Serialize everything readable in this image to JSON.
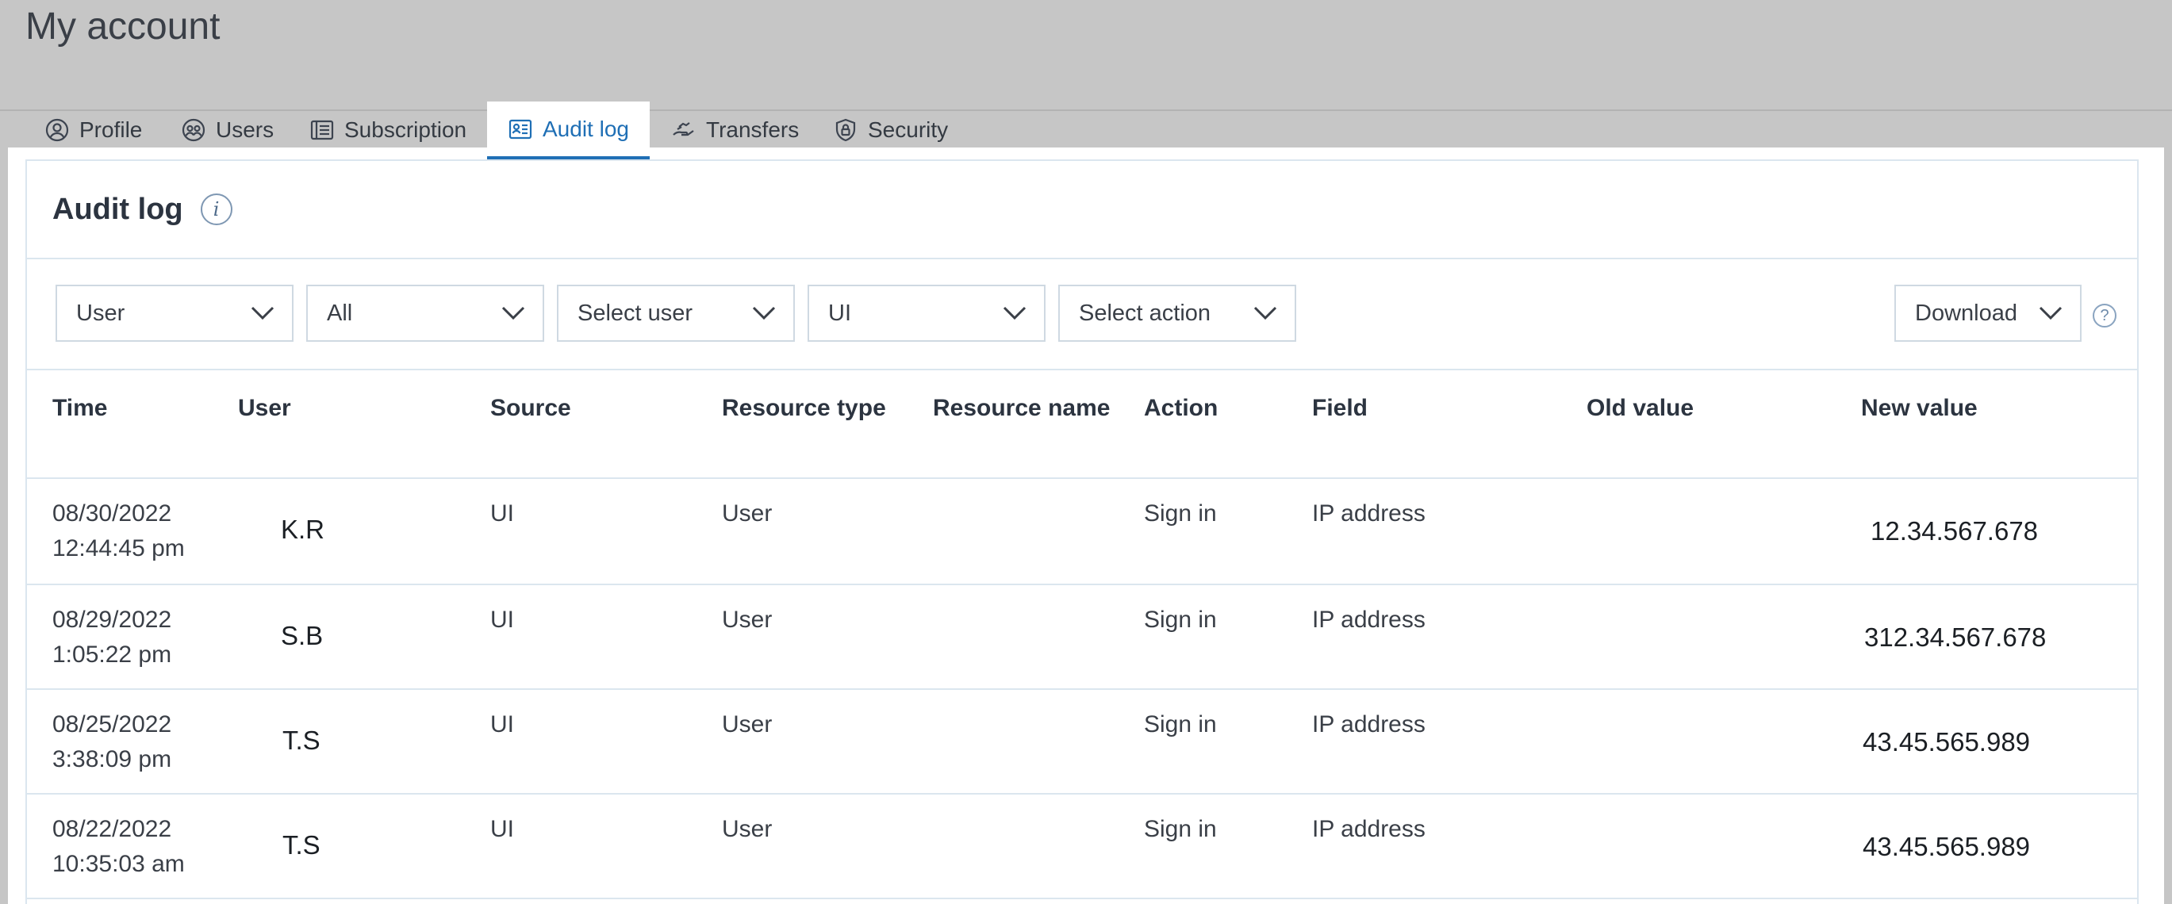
{
  "page": {
    "title": "My account"
  },
  "tabs": [
    {
      "label": "Profile",
      "icon": "user-circle-icon"
    },
    {
      "label": "Users",
      "icon": "users-icon"
    },
    {
      "label": "Subscription",
      "icon": "document-icon"
    },
    {
      "label": "Audit log",
      "icon": "id-card-icon",
      "active": true
    },
    {
      "label": "Transfers",
      "icon": "hand-transfer-icon"
    },
    {
      "label": "Security",
      "icon": "shield-lock-icon"
    }
  ],
  "card": {
    "title": "Audit log",
    "info_symbol": "i"
  },
  "filters": {
    "type": "User",
    "scope": "All",
    "user": "Select user",
    "source": "UI",
    "action": "Select action",
    "download": "Download",
    "help_symbol": "?"
  },
  "table": {
    "columns": [
      "Time",
      "User",
      "Source",
      "Resource type",
      "Resource name",
      "Action",
      "Field",
      "Old value",
      "New value"
    ],
    "rows": [
      {
        "date": "08/30/2022",
        "time": "12:44:45 pm",
        "user": "K.R",
        "source": "UI",
        "resource_type": "User",
        "resource_name": "",
        "action": "Sign in",
        "field": "IP address",
        "old_value": "",
        "new_value": "12.34.567.678"
      },
      {
        "date": "08/29/2022",
        "time": "1:05:22 pm",
        "user": "S.B",
        "source": "UI",
        "resource_type": "User",
        "resource_name": "",
        "action": "Sign in",
        "field": "IP address",
        "old_value": "",
        "new_value": "312.34.567.678"
      },
      {
        "date": "08/25/2022",
        "time": "3:38:09 pm",
        "user": "T.S",
        "source": "UI",
        "resource_type": "User",
        "resource_name": "",
        "action": "Sign in",
        "field": "IP address",
        "old_value": "",
        "new_value": "43.45.565.989"
      },
      {
        "date": "08/22/2022",
        "time": "10:35:03 am",
        "user": "T.S",
        "source": "UI",
        "resource_type": "User",
        "resource_name": "",
        "action": "Sign in",
        "field": "IP address",
        "old_value": "",
        "new_value": "43.45.565.989"
      }
    ]
  },
  "colors": {
    "accent": "#1f6fb5",
    "background": "#c6c6c6",
    "border": "#dbe6ef"
  }
}
